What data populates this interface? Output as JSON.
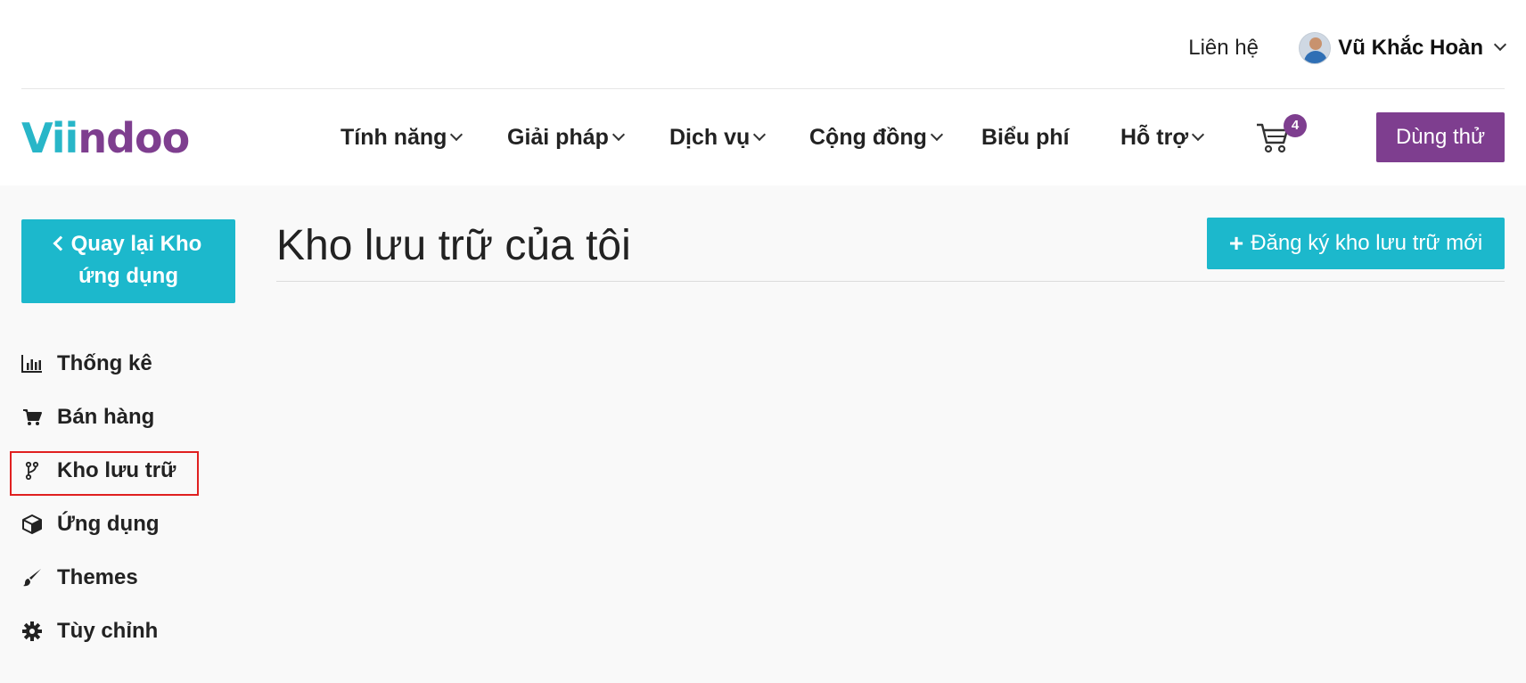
{
  "topbar": {
    "contact_label": "Liên hệ",
    "user_name": "Vũ Khắc Hoàn"
  },
  "navbar": {
    "logo_part1": "Vii",
    "logo_part2": "ndoo",
    "items": [
      {
        "label": "Tính năng",
        "has_dropdown": true
      },
      {
        "label": "Giải pháp",
        "has_dropdown": true
      },
      {
        "label": "Dịch vụ",
        "has_dropdown": true
      },
      {
        "label": "Cộng đồng",
        "has_dropdown": true
      },
      {
        "label": "Biểu phí",
        "has_dropdown": false
      },
      {
        "label": "Hỗ trợ",
        "has_dropdown": true
      }
    ],
    "cart_count": "4",
    "trial_label": "Dùng thử"
  },
  "sidebar": {
    "back_label_line1": "Quay lại Kho",
    "back_label_line2": "ứng dụng",
    "items": [
      {
        "label": "Thống kê",
        "icon": "bar-chart-icon"
      },
      {
        "label": "Bán hàng",
        "icon": "cart-icon"
      },
      {
        "label": "Kho lưu trữ",
        "icon": "code-fork-icon",
        "active": true
      },
      {
        "label": "Ứng dụng",
        "icon": "cube-icon"
      },
      {
        "label": "Themes",
        "icon": "paint-brush-icon"
      },
      {
        "label": "Tùy chỉnh",
        "icon": "gear-icon"
      }
    ]
  },
  "main": {
    "title": "Kho lưu trữ của tôi",
    "new_repo_label": "Đăng ký kho lưu trữ mới"
  },
  "colors": {
    "brand_teal": "#1cb8cc",
    "brand_purple": "#7e3e8f",
    "highlight_red": "#e02020"
  }
}
